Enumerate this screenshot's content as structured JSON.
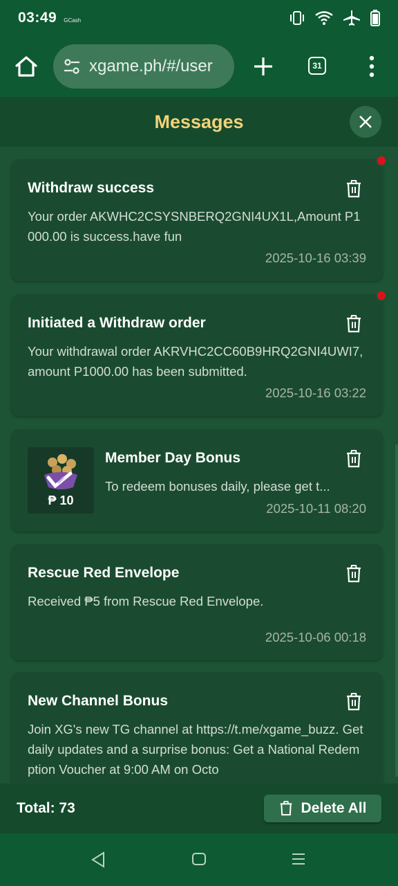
{
  "status_bar": {
    "time": "03:49",
    "app_label": "GCash"
  },
  "browser": {
    "url": "xgame.ph/#/user",
    "tab_count": "31"
  },
  "header": {
    "title": "Messages"
  },
  "messages": [
    {
      "title": "Withdraw success",
      "body": "Your order AKWHC2CSYSNBERQ2GNI4UX1L,Amount P1000.00 is success.have fun",
      "time": "2025-10-16 03:39",
      "unread": true
    },
    {
      "title": "Initiated a Withdraw order",
      "body": "Your withdrawal order AKRVHC2CC60B9HRQ2GNI4UWI7,amount P1000.00 has been submitted.",
      "time": "2025-10-16 03:22",
      "unread": true
    },
    {
      "title": "Member Day Bonus",
      "body": "To redeem bonuses daily, please get t...",
      "time": "2025-10-11 08:20",
      "thumb_label": "₱ 10",
      "unread": false
    },
    {
      "title": "Rescue Red Envelope",
      "body": "Received ₱5 from Rescue Red Envelope.",
      "time": "2025-10-06 00:18",
      "unread": false
    },
    {
      "title": "New Channel Bonus",
      "body": "Join XG's new TG channel at https://t.me/xgame_buzz. Get daily updates and a surprise bonus: Get a National Redemption Voucher at 9:00 AM on Octo",
      "unread": false
    }
  ],
  "footer": {
    "total_label": "Total: 73",
    "delete_all_label": "Delete All"
  },
  "colors": {
    "background": "#1d5435",
    "card": "#1a4b30",
    "header_title": "#f2d27a",
    "unread_dot": "#e0101a"
  }
}
